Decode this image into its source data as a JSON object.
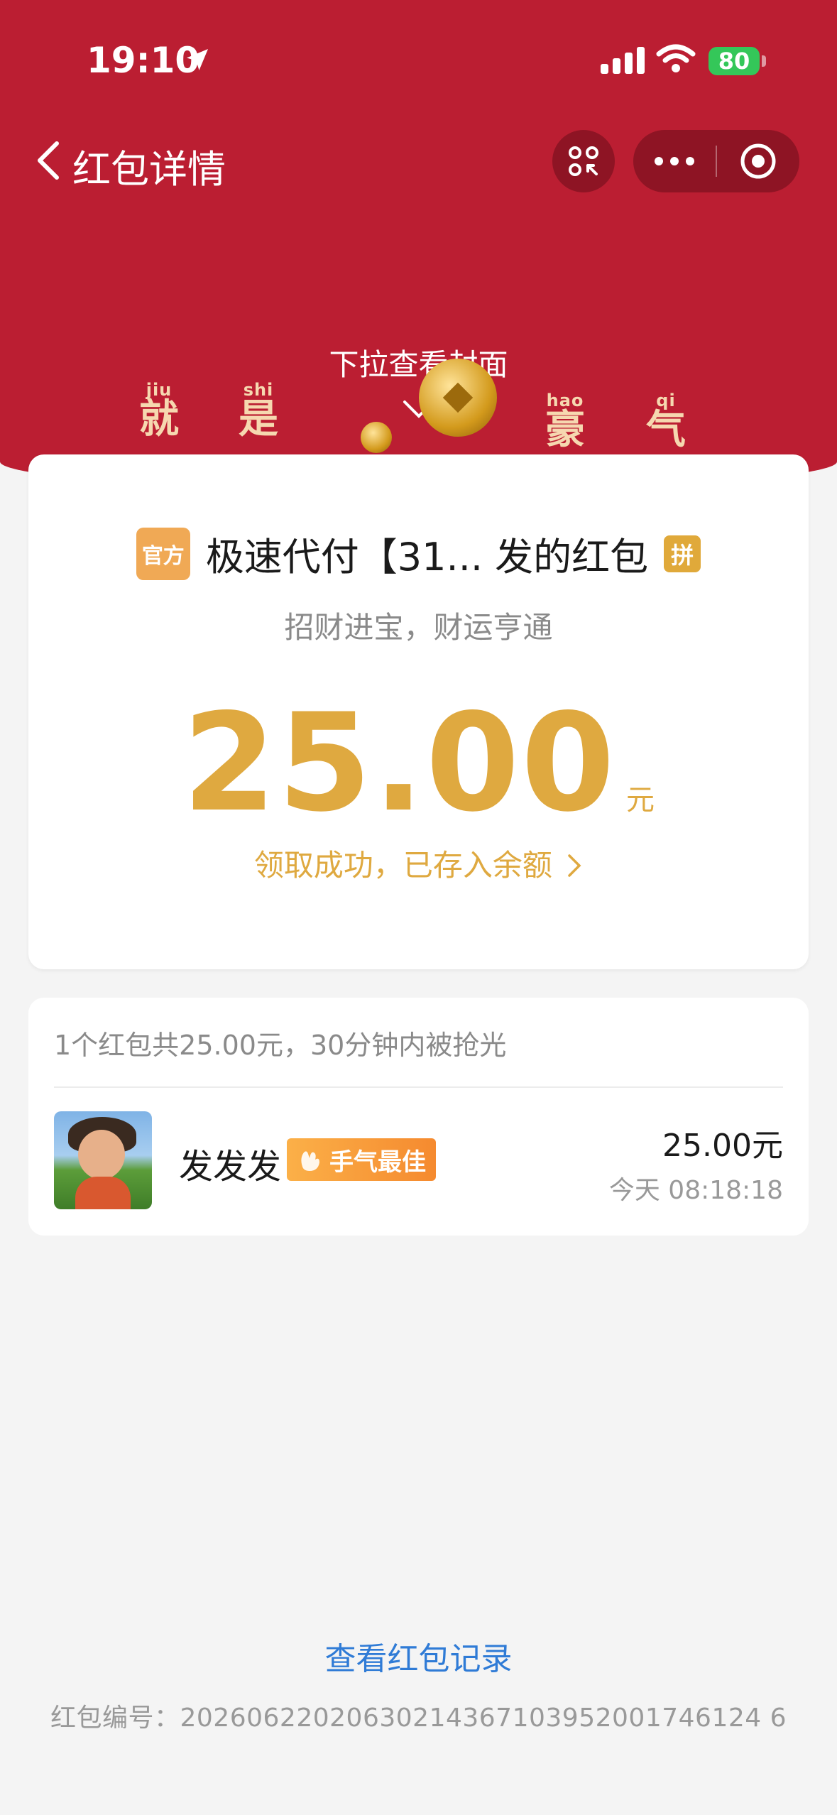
{
  "status_bar": {
    "time": "19:10",
    "battery": "80",
    "icons": [
      "location-arrow-icon",
      "cellular-signal-icon",
      "wifi-icon",
      "battery-icon"
    ]
  },
  "nav": {
    "title": "红包详情",
    "icons": [
      "back-chevron-icon",
      "scan-icon",
      "more-dots-icon",
      "close-target-icon"
    ]
  },
  "cover": {
    "hint": "下拉查看封面",
    "words": [
      {
        "pinyin": "jiu",
        "char": "就"
      },
      {
        "pinyin": "shi",
        "char": "是"
      },
      {
        "pinyin": "hao",
        "char": "豪"
      },
      {
        "pinyin": "qi",
        "char": "气"
      }
    ]
  },
  "packet": {
    "official_badge": "官方",
    "sender": "极速代付【31... 发的红包",
    "pin_badge": "拼",
    "blessing": "招财进宝，财运亨通",
    "amount": "25.00",
    "unit": "元",
    "status": "领取成功，已存入余额"
  },
  "receivers": {
    "summary": "1个红包共25.00元，30分钟内被抢光",
    "items": [
      {
        "name": "发发发",
        "badge": "手气最佳",
        "amount": "25.00元",
        "time": "今天 08:18:18"
      }
    ]
  },
  "footer": {
    "record_link": "查看红包记录",
    "serial": "红包编号：20260622020630214367103952001746124 6"
  },
  "colors": {
    "header_red": "#bb1e32",
    "gold": "#dfa940",
    "link_blue": "#2f7bd6",
    "battery_green": "#34c759"
  }
}
